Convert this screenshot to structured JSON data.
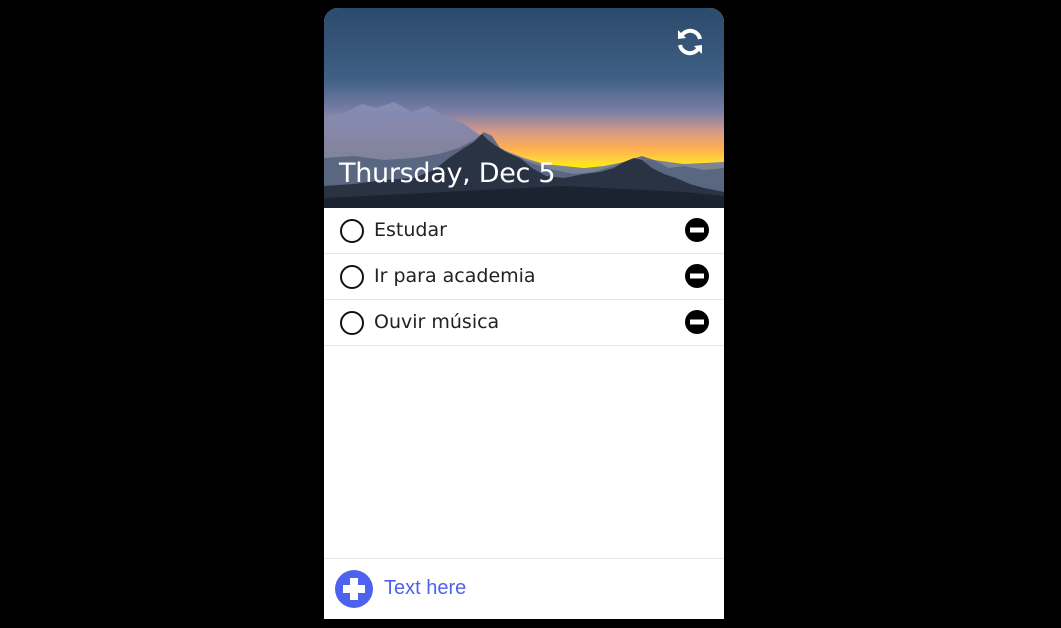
{
  "header": {
    "date_title": "Thursday, Dec 5",
    "refresh_icon": "refresh-icon"
  },
  "tasks": [
    {
      "label": "Estudar",
      "done": false
    },
    {
      "label": "Ir para academia",
      "done": false
    },
    {
      "label": "Ouvir música",
      "done": false
    }
  ],
  "footer": {
    "add_icon": "plus-circle-icon",
    "input_placeholder": "Text here",
    "input_value": ""
  },
  "colors": {
    "accent": "#4d63f0",
    "page_background": "#000000",
    "card_background": "#ffffff",
    "sky_top": "#2b4a6c",
    "sky_glow": "#ffb447"
  }
}
